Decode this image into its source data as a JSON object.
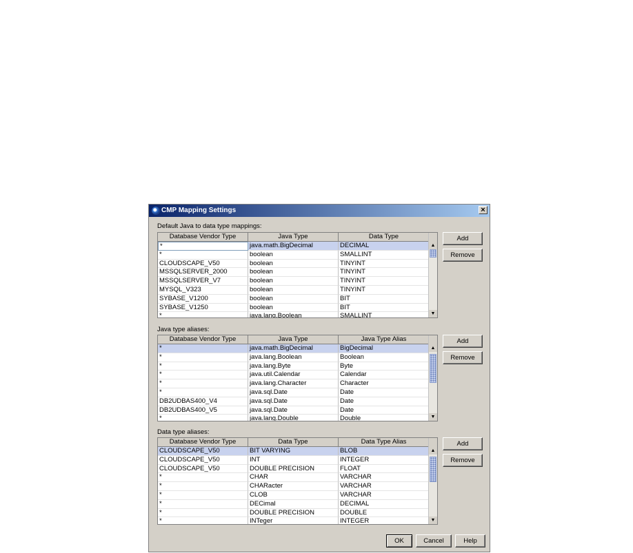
{
  "dialog": {
    "title": "CMP Mapping Settings",
    "close_label": "×",
    "ok_label": "OK",
    "cancel_label": "Cancel",
    "help_label": "Help"
  },
  "section1": {
    "label": "Default Java to data type mappings:",
    "headers": [
      "Database Vendor Type",
      "Java Type",
      "Data Type"
    ],
    "add_label": "Add",
    "remove_label": "Remove",
    "rows": [
      [
        "*",
        "java.math.BigDecimal",
        "DECIMAL"
      ],
      [
        "*",
        "boolean",
        "SMALLINT"
      ],
      [
        "CLOUDSCAPE_V50",
        "boolean",
        "TINYINT"
      ],
      [
        "MSSQLSERVER_2000",
        "boolean",
        "TINYINT"
      ],
      [
        "MSSQLSERVER_V7",
        "boolean",
        "TINYINT"
      ],
      [
        "MYSQL_V323",
        "boolean",
        "TINYINT"
      ],
      [
        "SYBASE_V1200",
        "boolean",
        "BIT"
      ],
      [
        "SYBASE_V1250",
        "boolean",
        "BIT"
      ],
      [
        "*",
        "java.lang.Boolean",
        "SMALLINT"
      ]
    ]
  },
  "section2": {
    "label": "Java type aliases:",
    "headers": [
      "Database Vendor Type",
      "Java Type",
      "Java Type Alias"
    ],
    "add_label": "Add",
    "remove_label": "Remove",
    "rows": [
      [
        "*",
        "java.math.BigDecimal",
        "BigDecimal"
      ],
      [
        "*",
        "java.lang.Boolean",
        "Boolean"
      ],
      [
        "*",
        "java.lang.Byte",
        "Byte"
      ],
      [
        "*",
        "java.util.Calendar",
        "Calendar"
      ],
      [
        "*",
        "java.lang.Character",
        "Character"
      ],
      [
        "*",
        "java.sql.Date",
        "Date"
      ],
      [
        "DB2UDBAS400_V4",
        "java.sql.Date",
        "Date"
      ],
      [
        "DB2UDBAS400_V5",
        "java.sql.Date",
        "Date"
      ],
      [
        "*",
        "java.lang.Double",
        "Double"
      ]
    ]
  },
  "section3": {
    "label": "Data type aliases:",
    "headers": [
      "Database Vendor Type",
      "Data Type",
      "Data Type Alias"
    ],
    "add_label": "Add",
    "remove_label": "Remove",
    "rows": [
      [
        "CLOUDSCAPE_V50",
        "BIT VARYING",
        "BLOB"
      ],
      [
        "CLOUDSCAPE_V50",
        "INT",
        "INTEGER"
      ],
      [
        "CLOUDSCAPE_V50",
        "DOUBLE PRECISION",
        "FLOAT"
      ],
      [
        "*",
        "CHAR",
        "VARCHAR"
      ],
      [
        "*",
        "CHARacter",
        "VARCHAR"
      ],
      [
        "*",
        "CLOB",
        "VARCHAR"
      ],
      [
        "*",
        "DECimal",
        "DECIMAL"
      ],
      [
        "*",
        "DOUBLE PRECISION",
        "DOUBLE"
      ],
      [
        "*",
        "INTeger",
        "INTEGER"
      ]
    ]
  },
  "scroll": {
    "up_arrow": "▲",
    "down_arrow": "▼"
  }
}
